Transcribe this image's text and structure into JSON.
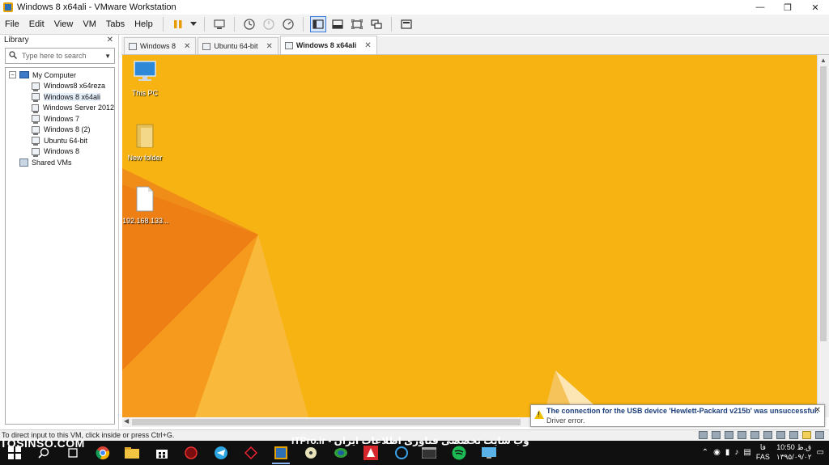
{
  "window": {
    "title": "Windows 8 x64ali - VMware Workstation",
    "minimize_glyph": "—",
    "maximize_glyph": "❐",
    "close_glyph": "✕"
  },
  "menu": {
    "file": "File",
    "edit": "Edit",
    "view": "View",
    "vm": "VM",
    "tabs": "Tabs",
    "help": "Help"
  },
  "library": {
    "title": "Library",
    "close_glyph": "✕",
    "search_placeholder": "Type here to search",
    "root": "My Computer",
    "vms": [
      {
        "label": "Windows8 x64reza"
      },
      {
        "label": "Windows 8 x64ali"
      },
      {
        "label": "Windows Server 2012"
      },
      {
        "label": "Windows 7"
      },
      {
        "label": "Windows 8 (2)"
      },
      {
        "label": "Ubuntu 64-bit"
      },
      {
        "label": "Windows 8"
      }
    ],
    "shared": "Shared VMs"
  },
  "tabs": [
    {
      "label": "Windows 8"
    },
    {
      "label": "Ubuntu 64-bit"
    },
    {
      "label": "Windows 8 x64ali"
    }
  ],
  "desktop": {
    "icons": [
      {
        "label": "This PC"
      },
      {
        "label": "New folder"
      },
      {
        "label": "192.168.133..."
      }
    ]
  },
  "notification": {
    "message": "The connection for the USB device 'Hewlett-Packard v215b' was unsuccessful.",
    "detail": "Driver error."
  },
  "statusbar": {
    "text": "To direct input to this VM, click inside or press Ctrl+G."
  },
  "taskbar": {
    "watermark_left": "TOSINSO.COM",
    "watermark_mid": "ITPro.ir - وب سایت تخصصی فناوری اطلاعات ایران",
    "time": "10:50 ق.ظ",
    "date": "۱۳۹۵/۰۹/۰۲",
    "lang_top": "فا",
    "lang_bottom": "FAS"
  },
  "colors": {
    "desktop_orange": "#f7b312",
    "desktop_dark": "#ef7d13",
    "accent_blue": "#3a7bd5"
  }
}
